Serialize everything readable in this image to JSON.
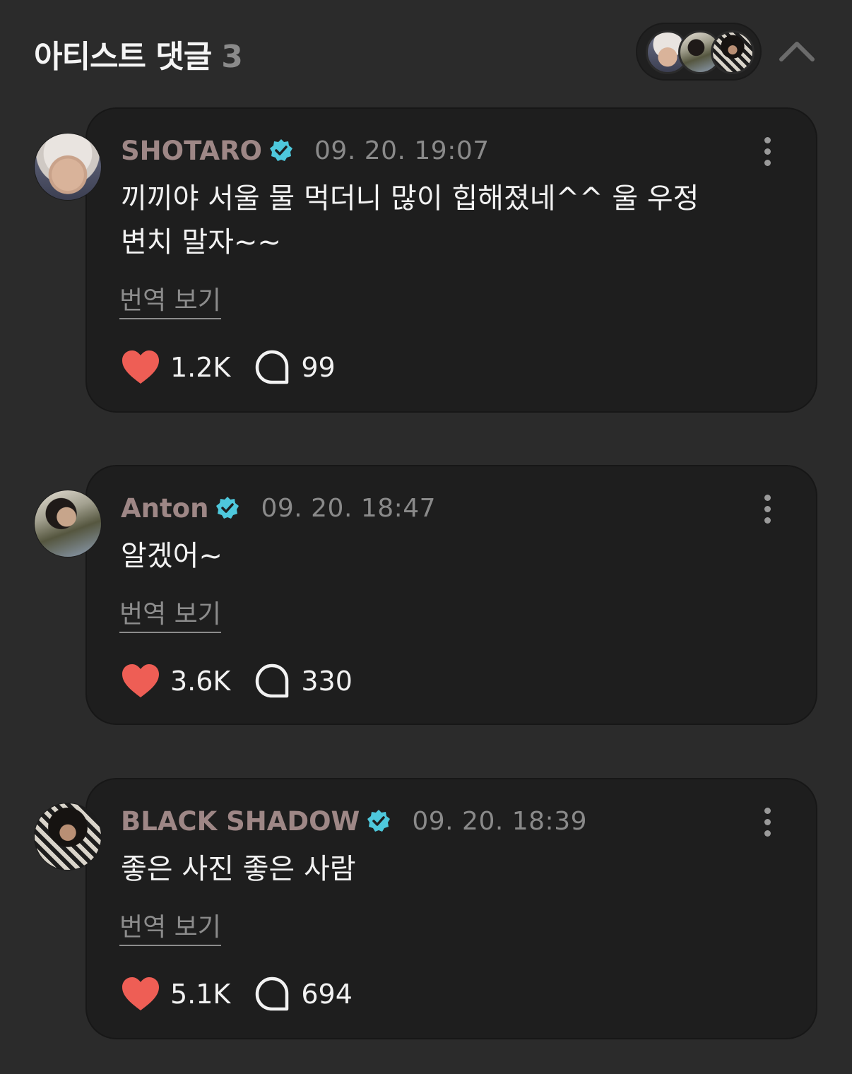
{
  "header": {
    "title": "아티스트 댓글",
    "count": "3",
    "stack_avatars": [
      "shotaro-avatar",
      "anton-avatar",
      "black-shadow-avatar"
    ]
  },
  "comments": [
    {
      "author": "SHOTARO",
      "timestamp": "09. 20. 19:07",
      "text": "끼끼야 서울 물 먹더니 많이 힙해졌네^^ 울 우정 변치 말자~~",
      "translate_label": "번역 보기",
      "likes": "1.2K",
      "replies": "99"
    },
    {
      "author": "Anton",
      "timestamp": "09. 20. 18:47",
      "text": "알겠어~",
      "translate_label": "번역 보기",
      "likes": "3.6K",
      "replies": "330"
    },
    {
      "author": "BLACK SHADOW",
      "timestamp": "09. 20. 18:39",
      "text": "좋은 사진 좋은 사람",
      "translate_label": "번역 보기",
      "likes": "5.1K",
      "replies": "694"
    }
  ],
  "colors": {
    "background": "#2b2b2b",
    "card": "#1e1e1e",
    "author": "#9e8786",
    "verified": "#4ec8dc",
    "heart": "#ee5e55",
    "muted": "#8a8a8a"
  },
  "icons": {
    "verified": "verified-badge-icon",
    "like": "heart-icon",
    "reply": "speech-bubble-icon",
    "more": "more-vertical-icon",
    "collapse": "chevron-up-icon"
  }
}
